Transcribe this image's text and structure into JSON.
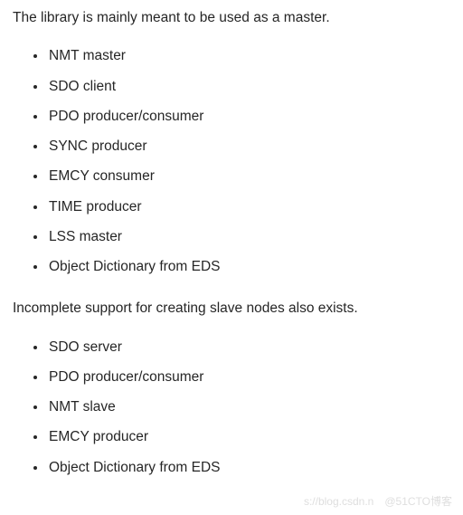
{
  "para1": "The library is mainly meant to be used as a master.",
  "list1": [
    "NMT master",
    "SDO client",
    "PDO producer/consumer",
    "SYNC producer",
    "EMCY consumer",
    "TIME producer",
    "LSS master",
    "Object Dictionary from EDS"
  ],
  "para2": "Incomplete support for creating slave nodes also exists.",
  "list2": [
    "SDO server",
    "PDO producer/consumer",
    "NMT slave",
    "EMCY producer",
    "Object Dictionary from EDS"
  ],
  "watermark": {
    "left": "s://blog.csdn.n",
    "right": "@51CTO博客"
  }
}
